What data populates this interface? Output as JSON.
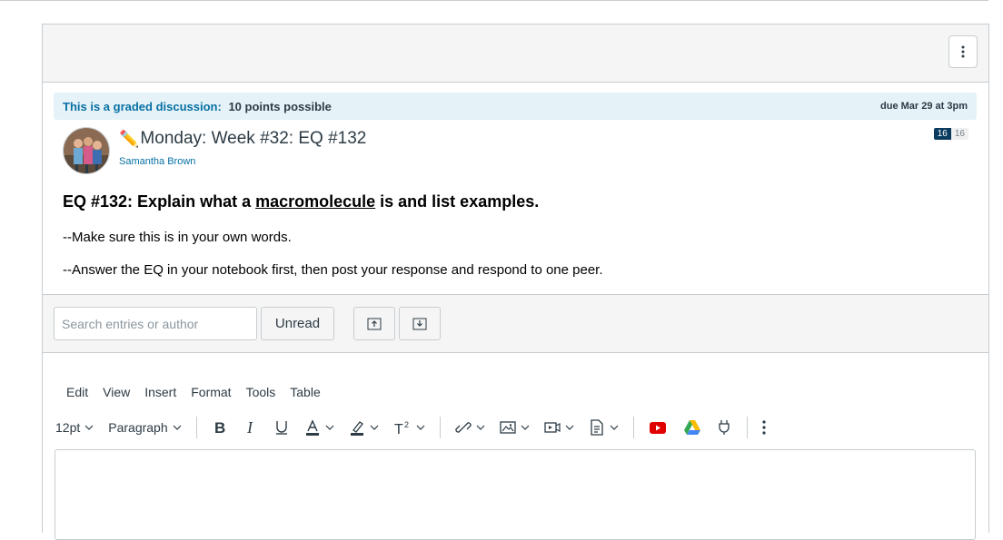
{
  "banner": {
    "graded_label": "This is a graded discussion:",
    "points": "10 points possible",
    "due": "due Mar 29 at 3pm"
  },
  "topic": {
    "title": "Monday: Week #32: EQ #132",
    "author": "Samantha Brown",
    "unread_count": "16",
    "total_count": "16"
  },
  "body": {
    "heading_prefix": "EQ #132: Explain what a ",
    "heading_term": "macromolecule",
    "heading_suffix": " is and list examples.",
    "line1": "--Make sure this is in your own words.",
    "line2": "--Answer the EQ in your notebook first, then post your response and respond to one peer."
  },
  "toolbar": {
    "search_placeholder": "Search entries or author",
    "unread_label": "Unread"
  },
  "editor": {
    "menu": [
      "Edit",
      "View",
      "Insert",
      "Format",
      "Tools",
      "Table"
    ],
    "font_size": "12pt",
    "block_format": "Paragraph"
  },
  "colors": {
    "link": "#0770a3",
    "banner_bg": "#e5f2f8",
    "badge_unread": "#0b3b5e",
    "youtube": "#e00000"
  }
}
